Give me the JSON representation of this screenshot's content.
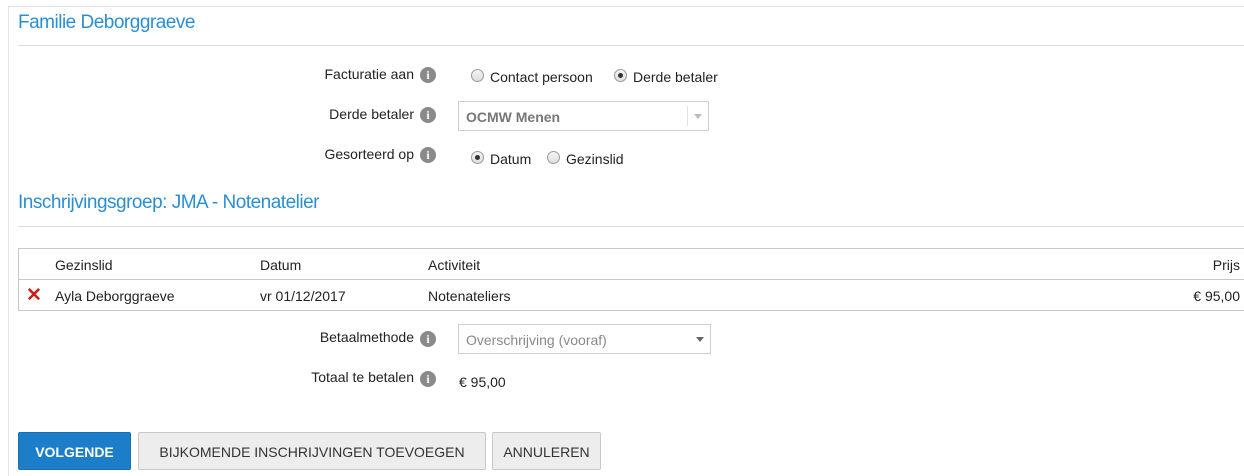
{
  "family": {
    "title": "Familie Deborggraeve"
  },
  "billing": {
    "facturatie_label": "Facturatie aan",
    "facturatie_options": [
      "Contact persoon",
      "Derde betaler"
    ],
    "facturatie_selected": "Derde betaler",
    "derde_betaler_label": "Derde betaler",
    "derde_betaler_value": "OCMW Menen",
    "sort_label": "Gesorteerd op",
    "sort_options": [
      "Datum",
      "Gezinslid"
    ],
    "sort_selected": "Datum"
  },
  "group": {
    "title": "Inschrijvingsgroep: JMA - Notenatelier"
  },
  "table": {
    "headers": [
      "Gezinslid",
      "Datum",
      "Activiteit",
      "Prijs"
    ],
    "rows": [
      {
        "gezinslid": "Ayla Deborggraeve",
        "datum": "vr 01/12/2017",
        "activiteit": "Notenateliers",
        "prijs": "€ 95,00"
      }
    ]
  },
  "payment": {
    "method_label": "Betaalmethode",
    "method_value": "Overschrijving (vooraf)",
    "total_label": "Totaal te betalen",
    "total_value": "€ 95,00"
  },
  "buttons": {
    "next": "VOLGENDE",
    "add_more": "BIJKOMENDE INSCHRIJVINGEN TOEVOEGEN",
    "cancel": "ANNULEREN"
  },
  "colors": {
    "accent": "#2a8fd0",
    "primary_button": "#1c7dc8",
    "delete": "#cc1f1a"
  },
  "icons": {
    "info": "info-icon",
    "delete": "delete-x-icon",
    "dropdown": "chevron-down-icon"
  }
}
